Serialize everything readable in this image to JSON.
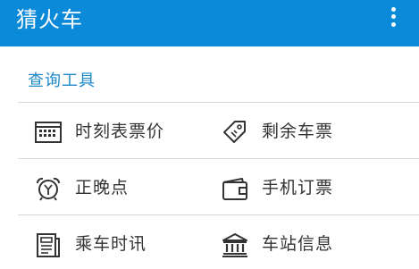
{
  "app": {
    "title": "猜火车"
  },
  "section": {
    "title": "查询工具"
  },
  "tools": [
    {
      "label": "时刻表票价",
      "icon": "timetable-icon"
    },
    {
      "label": "剩余车票",
      "icon": "ticket-tag-icon"
    },
    {
      "label": "正晚点",
      "icon": "alarm-clock-icon"
    },
    {
      "label": "手机订票",
      "icon": "wallet-icon"
    },
    {
      "label": "乘车时讯",
      "icon": "news-document-icon"
    },
    {
      "label": "车站信息",
      "icon": "station-building-icon"
    }
  ],
  "colors": {
    "appbar": "#0a8ad8",
    "section_title": "#1e88c8",
    "label": "#333333",
    "divider": "#d6d6d6"
  }
}
